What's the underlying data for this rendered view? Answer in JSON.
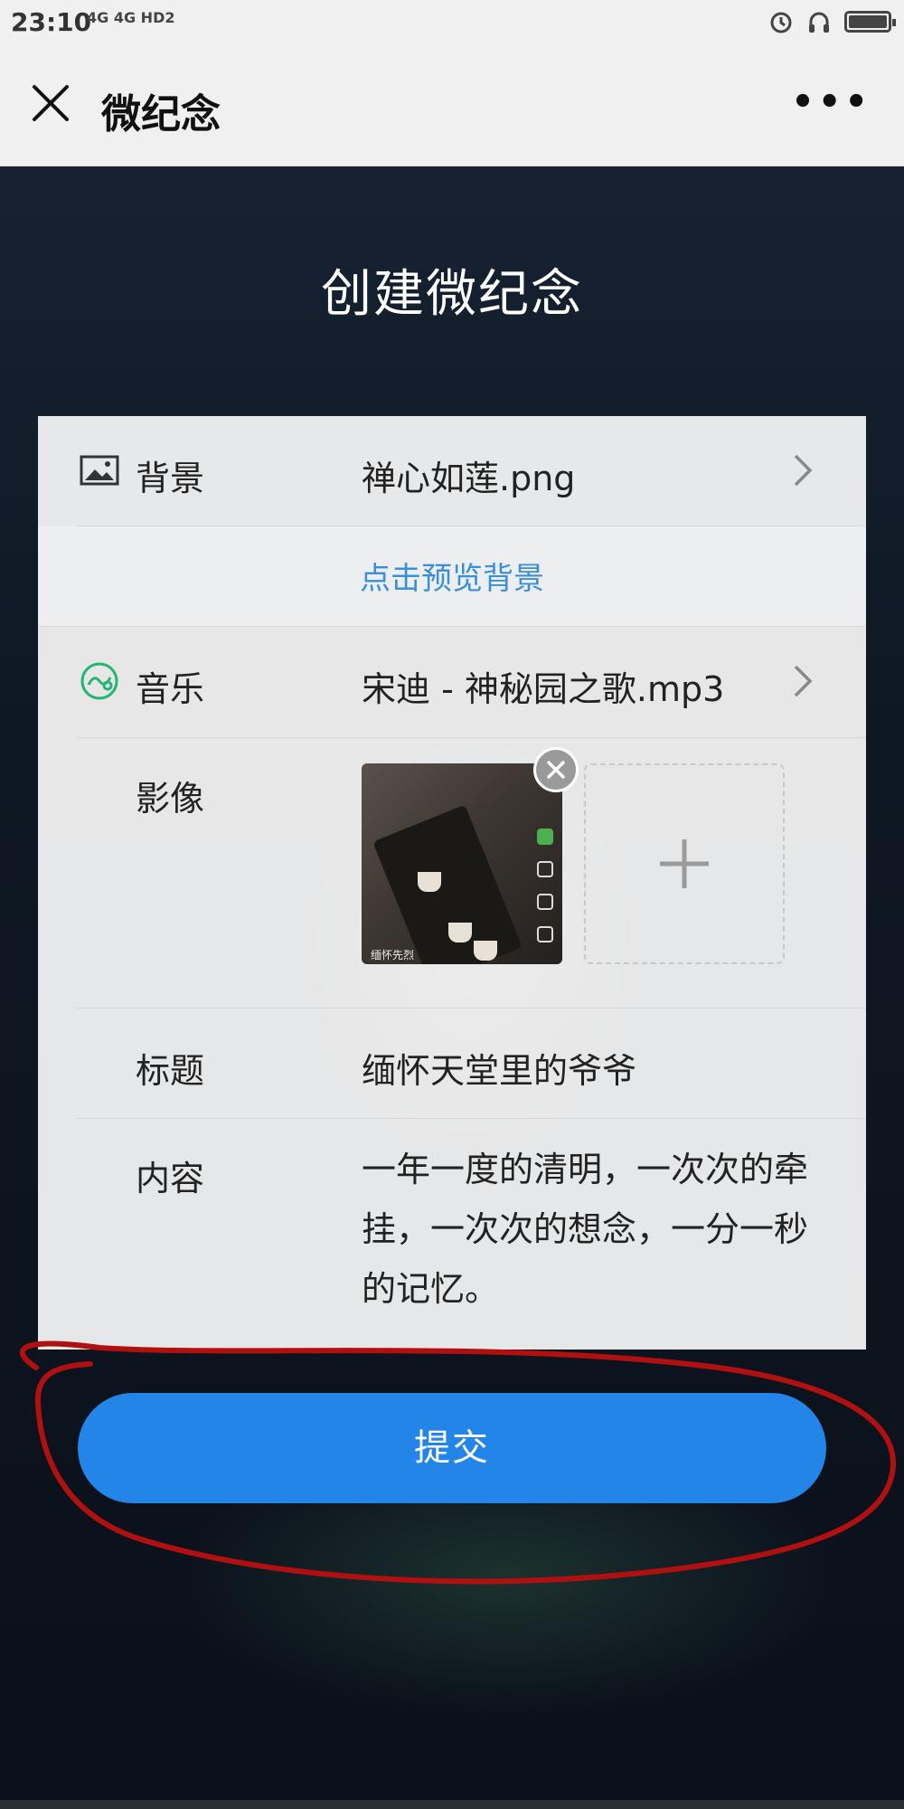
{
  "status_bar": {
    "time": "23:10",
    "network": "4G 4G HD2"
  },
  "nav": {
    "title": "微纪念",
    "close_icon": "close-icon",
    "more_icon": "more-icon"
  },
  "heading": "创建微纪念",
  "form": {
    "background": {
      "label": "背景",
      "value": "禅心如莲.png",
      "icon": "image-icon"
    },
    "preview_link": "点击预览背景",
    "music": {
      "label": "音乐",
      "value": "宋迪 - 神秘园之歌.mp3",
      "icon": "music-icon"
    },
    "image": {
      "label": "影像",
      "thumbnail_caption": "缅怀先烈"
    },
    "title": {
      "label": "标题",
      "value": "缅怀天堂里的爷爷"
    },
    "content": {
      "label": "内容",
      "value": "一年一度的清明，一次次的牵挂，一次次的想念，一分一秒的记忆。"
    }
  },
  "submit_label": "提交",
  "colors": {
    "accent": "#2385e8",
    "link": "#3b8fd9",
    "music_icon": "#22b573",
    "annotation": "#b01010"
  }
}
